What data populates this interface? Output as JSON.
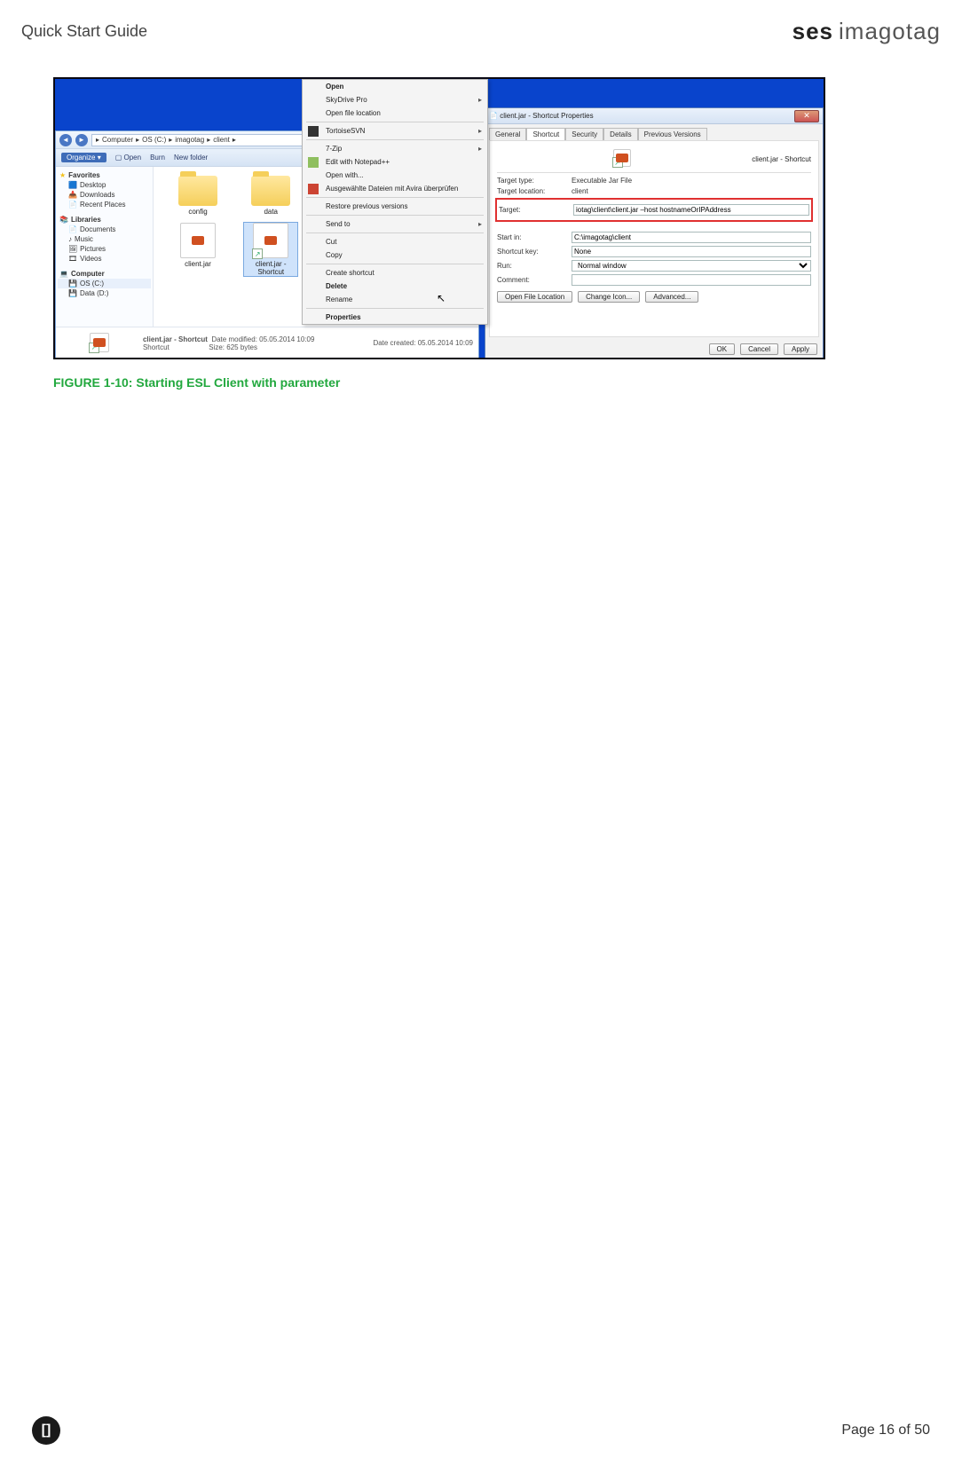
{
  "header": {
    "title": "Quick Start Guide",
    "logo_left": "ses",
    "logo_right": "imagotag"
  },
  "figure_caption": "FIGURE 1-10: Starting ESL Client with parameter",
  "footer": {
    "badge": "[]",
    "page_text": "Page 16 of 50"
  },
  "explorer": {
    "breadcrumb": [
      "Computer",
      "OS (C:)",
      "imagotag",
      "client"
    ],
    "toolbar": {
      "organize": "Organize",
      "open": "Open",
      "burn": "Burn",
      "newfolder": "New folder"
    },
    "sidebar": {
      "favorites": {
        "label": "Favorites",
        "items": [
          "Desktop",
          "Downloads",
          "Recent Places"
        ]
      },
      "libraries": {
        "label": "Libraries",
        "items": [
          "Documents",
          "Music",
          "Pictures",
          "Videos"
        ]
      },
      "computer": {
        "label": "Computer",
        "items": [
          "OS (C:)",
          "Data (D:)"
        ]
      }
    },
    "files": {
      "folders": [
        "config",
        "data"
      ],
      "jar": "client.jar",
      "shortcut": "client.jar - Shortcut"
    },
    "status": {
      "name": "client.jar - Shortcut",
      "type": "Shortcut",
      "mod_label": "Date modified:",
      "mod": "05.05.2014 10:09",
      "size_label": "Size:",
      "size": "625 bytes",
      "created_label": "Date created:",
      "created": "05.05.2014 10:09"
    }
  },
  "context_menu": {
    "items": [
      {
        "label": "Open",
        "bold": true
      },
      {
        "label": "SkyDrive Pro",
        "sub": true
      },
      {
        "label": "Open file location"
      },
      {
        "sep": true
      },
      {
        "label": "TortoiseSVN",
        "sub": true,
        "icon": "blk"
      },
      {
        "sep": true
      },
      {
        "label": "7-Zip",
        "sub": true
      },
      {
        "label": "Edit with Notepad++",
        "icon": "np"
      },
      {
        "label": "Open with..."
      },
      {
        "label": "Ausgewählte Dateien mit Avira überprüfen",
        "icon": "red"
      },
      {
        "sep": true
      },
      {
        "label": "Restore previous versions"
      },
      {
        "sep": true
      },
      {
        "label": "Send to",
        "sub": true
      },
      {
        "sep": true
      },
      {
        "label": "Cut"
      },
      {
        "label": "Copy"
      },
      {
        "sep": true
      },
      {
        "label": "Create shortcut"
      },
      {
        "label": "Delete",
        "bold": true
      },
      {
        "label": "Rename"
      },
      {
        "sep": true
      },
      {
        "label": "Properties",
        "bold": true
      }
    ]
  },
  "properties": {
    "title": "client.jar - Shortcut Properties",
    "tabs": [
      "General",
      "Shortcut",
      "Security",
      "Details",
      "Previous Versions"
    ],
    "active_tab": 1,
    "name": "client.jar - Shortcut",
    "fields": {
      "target_type_label": "Target type:",
      "target_type": "Executable Jar File",
      "target_loc_label": "Target location:",
      "target_loc": "client",
      "target_label": "Target:",
      "target": "iotag\\client\\client.jar –host hostnameOrIPAddress",
      "startin_label": "Start in:",
      "startin": "C:\\imagotag\\client",
      "shortcut_key_label": "Shortcut key:",
      "shortcut_key": "None",
      "run_label": "Run:",
      "run": "Normal window",
      "comment_label": "Comment:",
      "comment": ""
    },
    "buttons": {
      "openloc": "Open File Location",
      "icon": "Change Icon...",
      "advanced": "Advanced..."
    },
    "dlg_buttons": {
      "ok": "OK",
      "cancel": "Cancel",
      "apply": "Apply"
    }
  }
}
